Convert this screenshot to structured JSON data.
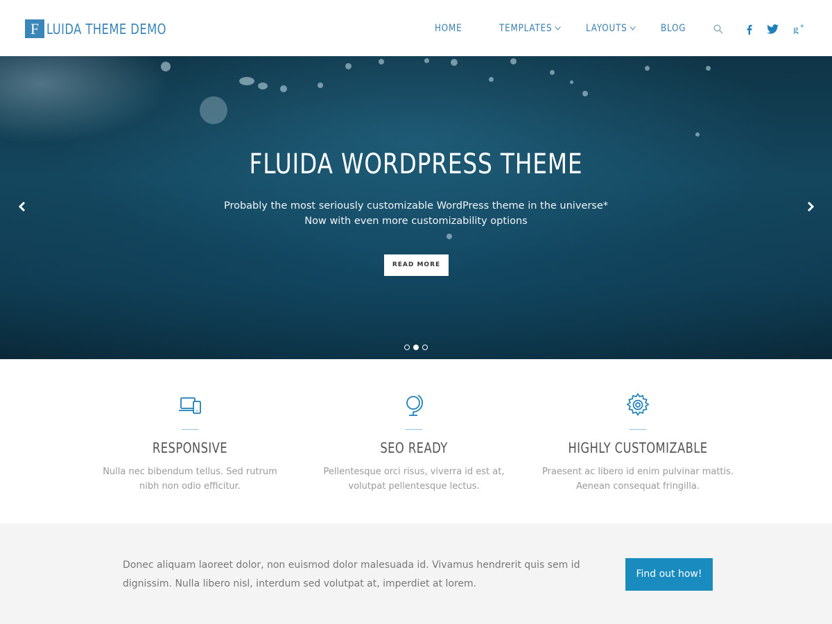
{
  "header": {
    "logo_letter": "F",
    "logo_text": "LUIDA THEME DEMO",
    "nav": {
      "home": "HOME",
      "templates": "TEMPLATES",
      "layouts": "LAYOUTS",
      "blog": "BLOG"
    },
    "icons": [
      "search-icon",
      "facebook-icon",
      "twitter-icon",
      "google-plus-icon"
    ]
  },
  "hero": {
    "title": "FLUIDA WORDPRESS THEME",
    "subtitle_line1": "Probably the most seriously customizable WordPress theme in the universe*",
    "subtitle_line2": "Now with even more customizability options",
    "button_label": "READ MORE",
    "slide_count": 3,
    "active_slide": 2
  },
  "features": [
    {
      "icon": "devices-icon",
      "title": "RESPONSIVE",
      "text": "Nulla nec bibendum tellus. Sed rutrum nibh non odio efficitur."
    },
    {
      "icon": "globe-icon",
      "title": "SEO READY",
      "text": "Pellentesque orci risus, viverra id est at, volutpat pellentesque lectus."
    },
    {
      "icon": "gear-icon",
      "title": "HIGHLY CUSTOMIZABLE",
      "text": "Praesent ac libero id enim pulvinar mattis. Aenean consequat fringilla."
    }
  ],
  "cta": {
    "text": "Donec aliquam laoreet dolor, non euismod dolor malesuada id. Vivamus hendrerit quis sem id dignissim. Nulla libero nisl, interdum sed volutpat at, imperdiet at lorem.",
    "button_label": "Find out how!"
  },
  "colors": {
    "accent": "#3b86b8",
    "cta_button": "#1a8bbf",
    "cta_background": "#f4f4f4"
  }
}
